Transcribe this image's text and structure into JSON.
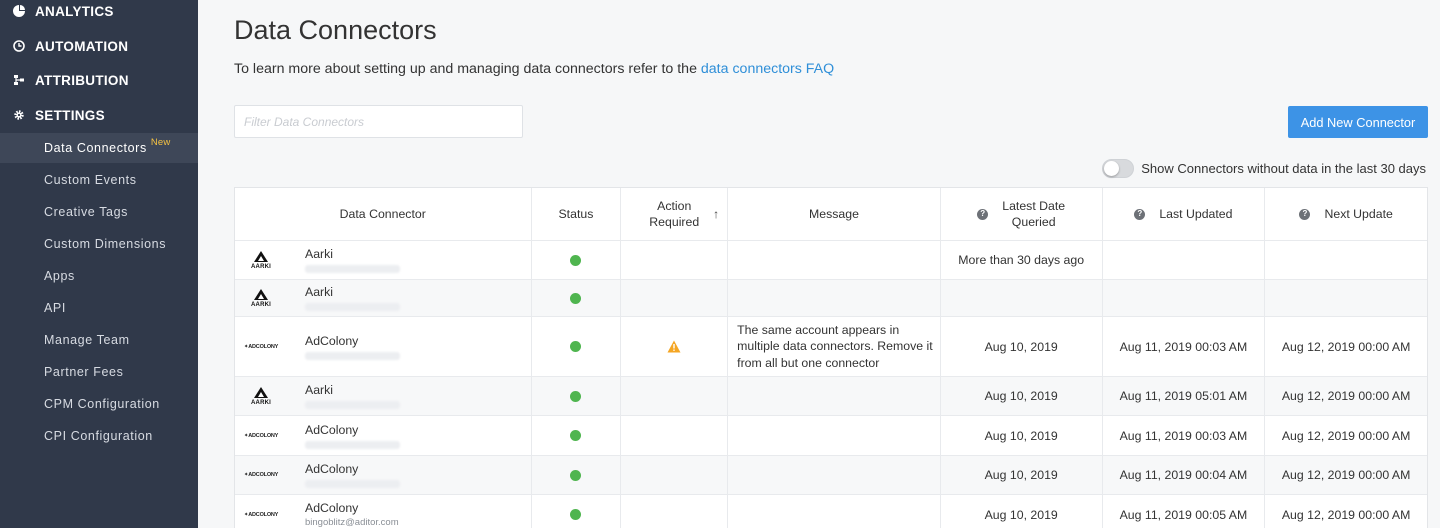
{
  "sidebar": {
    "sections": [
      {
        "label": "ANALYTICS",
        "icon": "pie-chart-icon"
      },
      {
        "label": "AUTOMATION",
        "icon": "clock-icon"
      },
      {
        "label": "ATTRIBUTION",
        "icon": "attribution-icon"
      },
      {
        "label": "SETTINGS",
        "icon": "gear-icon"
      }
    ],
    "items": [
      {
        "label": "Data Connectors",
        "badge": "New",
        "active": true
      },
      {
        "label": "Custom Events"
      },
      {
        "label": "Creative Tags"
      },
      {
        "label": "Custom Dimensions"
      },
      {
        "label": "Apps"
      },
      {
        "label": "API"
      },
      {
        "label": "Manage Team"
      },
      {
        "label": "Partner Fees"
      },
      {
        "label": "CPM Configuration"
      },
      {
        "label": "CPI Configuration"
      }
    ]
  },
  "page": {
    "title": "Data Connectors",
    "intro_text": "To learn more about setting up and managing data connectors refer to the ",
    "intro_link": "data connectors FAQ",
    "filter_placeholder": "Filter Data Connectors",
    "add_button": "Add New Connector",
    "toggle_label": "Show Connectors without data in the last 30 days"
  },
  "table": {
    "headers": {
      "connector": "Data Connector",
      "status": "Status",
      "action_line1": "Action",
      "action_line2": "Required",
      "message": "Message",
      "latest_line1": "Latest Date",
      "latest_line2": "Queried",
      "last_updated": "Last Updated",
      "next_update": "Next Update"
    },
    "rows": [
      {
        "name": "Aarki",
        "logo": "aarki",
        "status": "ok",
        "action": "",
        "message": "",
        "latest": "More than 30 days ago",
        "last_updated": "",
        "next_update": ""
      },
      {
        "name": "Aarki",
        "logo": "aarki",
        "status": "ok",
        "action": "",
        "message": "",
        "latest": "",
        "last_updated": "",
        "next_update": ""
      },
      {
        "name": "AdColony",
        "logo": "adcolony",
        "status": "ok",
        "action": "warning",
        "message": "The same account appears in multiple data connectors. Remove it from all but one connector",
        "latest": "Aug 10, 2019",
        "last_updated": "Aug 11, 2019 00:03 AM",
        "next_update": "Aug 12, 2019 00:00 AM"
      },
      {
        "name": "Aarki",
        "logo": "aarki",
        "status": "ok",
        "action": "",
        "message": "",
        "latest": "Aug 10, 2019",
        "last_updated": "Aug 11, 2019 05:01 AM",
        "next_update": "Aug 12, 2019 00:00 AM"
      },
      {
        "name": "AdColony",
        "logo": "adcolony",
        "status": "ok",
        "action": "",
        "message": "",
        "latest": "Aug 10, 2019",
        "last_updated": "Aug 11, 2019 00:03 AM",
        "next_update": "Aug 12, 2019 00:00 AM"
      },
      {
        "name": "AdColony",
        "logo": "adcolony",
        "status": "ok",
        "action": "",
        "message": "",
        "latest": "Aug 10, 2019",
        "last_updated": "Aug 11, 2019 00:04 AM",
        "next_update": "Aug 12, 2019 00:00 AM"
      },
      {
        "name": "AdColony",
        "logo": "adcolony",
        "email": "bingoblitz@aditor.com",
        "status": "ok",
        "action": "",
        "message": "",
        "latest": "Aug 10, 2019",
        "last_updated": "Aug 11, 2019 00:05 AM",
        "next_update": "Aug 12, 2019 00:00 AM"
      }
    ]
  },
  "logo_text": {
    "aarki": "AARKI",
    "adcolony": "✦ADCOLONY"
  },
  "colors": {
    "sidebar": "#30394a",
    "accent": "#3d93e6",
    "status_ok": "#4fb54f",
    "warning": "#f5a623"
  }
}
